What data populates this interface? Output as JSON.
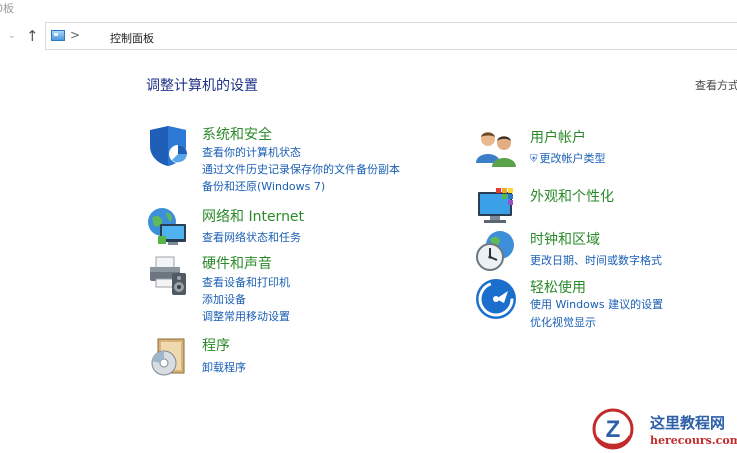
{
  "window": {
    "title_fragment": "0板"
  },
  "address": {
    "dropdown_icon": "chevron-down-icon",
    "up_icon": "up-arrow-icon",
    "separator": ">",
    "crumb": "控制面板"
  },
  "main": {
    "title": "调整计算机的设置",
    "view_by": "查看方式"
  },
  "categories": {
    "system_security": {
      "title": "系统和安全",
      "icon": "shield-icon",
      "links": [
        "查看你的计算机状态",
        "通过文件历史记录保存你的文件备份副本",
        "备份和还原(Windows 7)"
      ]
    },
    "network": {
      "title": "网络和 Internet",
      "icon": "network-globe-icon",
      "links": [
        "查看网络状态和任务"
      ]
    },
    "hardware": {
      "title": "硬件和声音",
      "icon": "printer-speaker-icon",
      "links": [
        "查看设备和打印机",
        "添加设备",
        "调整常用移动设置"
      ]
    },
    "programs": {
      "title": "程序",
      "icon": "programs-disc-icon",
      "links": [
        "卸载程序"
      ]
    },
    "user_accounts": {
      "title": "用户帐户",
      "icon": "users-icon",
      "links": [
        "更改帐户类型"
      ]
    },
    "appearance": {
      "title": "外观和个性化",
      "icon": "monitor-palette-icon",
      "links": []
    },
    "clock_region": {
      "title": "时钟和区域",
      "icon": "clock-globe-icon",
      "links": [
        "更改日期、时间或数字格式"
      ]
    },
    "ease_access": {
      "title": "轻松使用",
      "icon": "ease-of-access-icon",
      "links": [
        "使用 Windows 建议的设置",
        "优化视觉显示"
      ]
    }
  },
  "watermark": {
    "name": "这里教程网",
    "domain": "herecours.com"
  },
  "colors": {
    "category_title": "#2a8a2a",
    "link": "#1a5fb4",
    "page_title": "#1e3287"
  }
}
